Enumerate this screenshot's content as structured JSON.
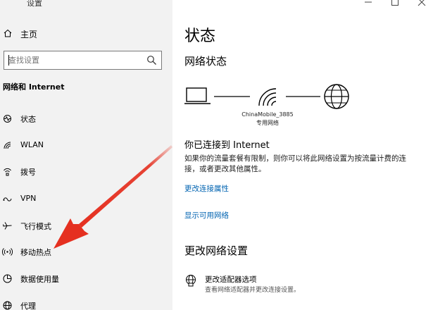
{
  "window": {
    "title": "设置"
  },
  "sidebar": {
    "home_label": "主页",
    "search": {
      "placeholder": "查找设置"
    },
    "section_title": "网络和 Internet",
    "items": [
      {
        "label": "状态",
        "icon": "status-icon"
      },
      {
        "label": "WLAN",
        "icon": "wifi-icon"
      },
      {
        "label": "拨号",
        "icon": "dialup-icon"
      },
      {
        "label": "VPN",
        "icon": "vpn-icon"
      },
      {
        "label": "飞行模式",
        "icon": "airplane-icon"
      },
      {
        "label": "移动热点",
        "icon": "hotspot-icon"
      },
      {
        "label": "数据使用量",
        "icon": "data-usage-icon"
      },
      {
        "label": "代理",
        "icon": "globe-icon"
      }
    ]
  },
  "main": {
    "title": "状态",
    "network_status_heading": "网络状态",
    "network_name": "ChinaMobile_3885",
    "network_type": "专用网络",
    "connected_title": "你已连接到 Internet",
    "connected_desc": "如果你的流量套餐有限制，则你可以将此网络设置为按流量计费的连接，或者更改其他属性。",
    "link_change_properties": "更改连接属性",
    "link_show_networks": "显示可用网络",
    "change_settings_heading": "更改网络设置",
    "adapter_title": "更改适配器选项",
    "adapter_desc": "查看网络适配器并更改连接设置。"
  },
  "colors": {
    "link": "#0063b1",
    "arrow": "#e53020",
    "sidebar_bg": "#f2f2f2"
  }
}
